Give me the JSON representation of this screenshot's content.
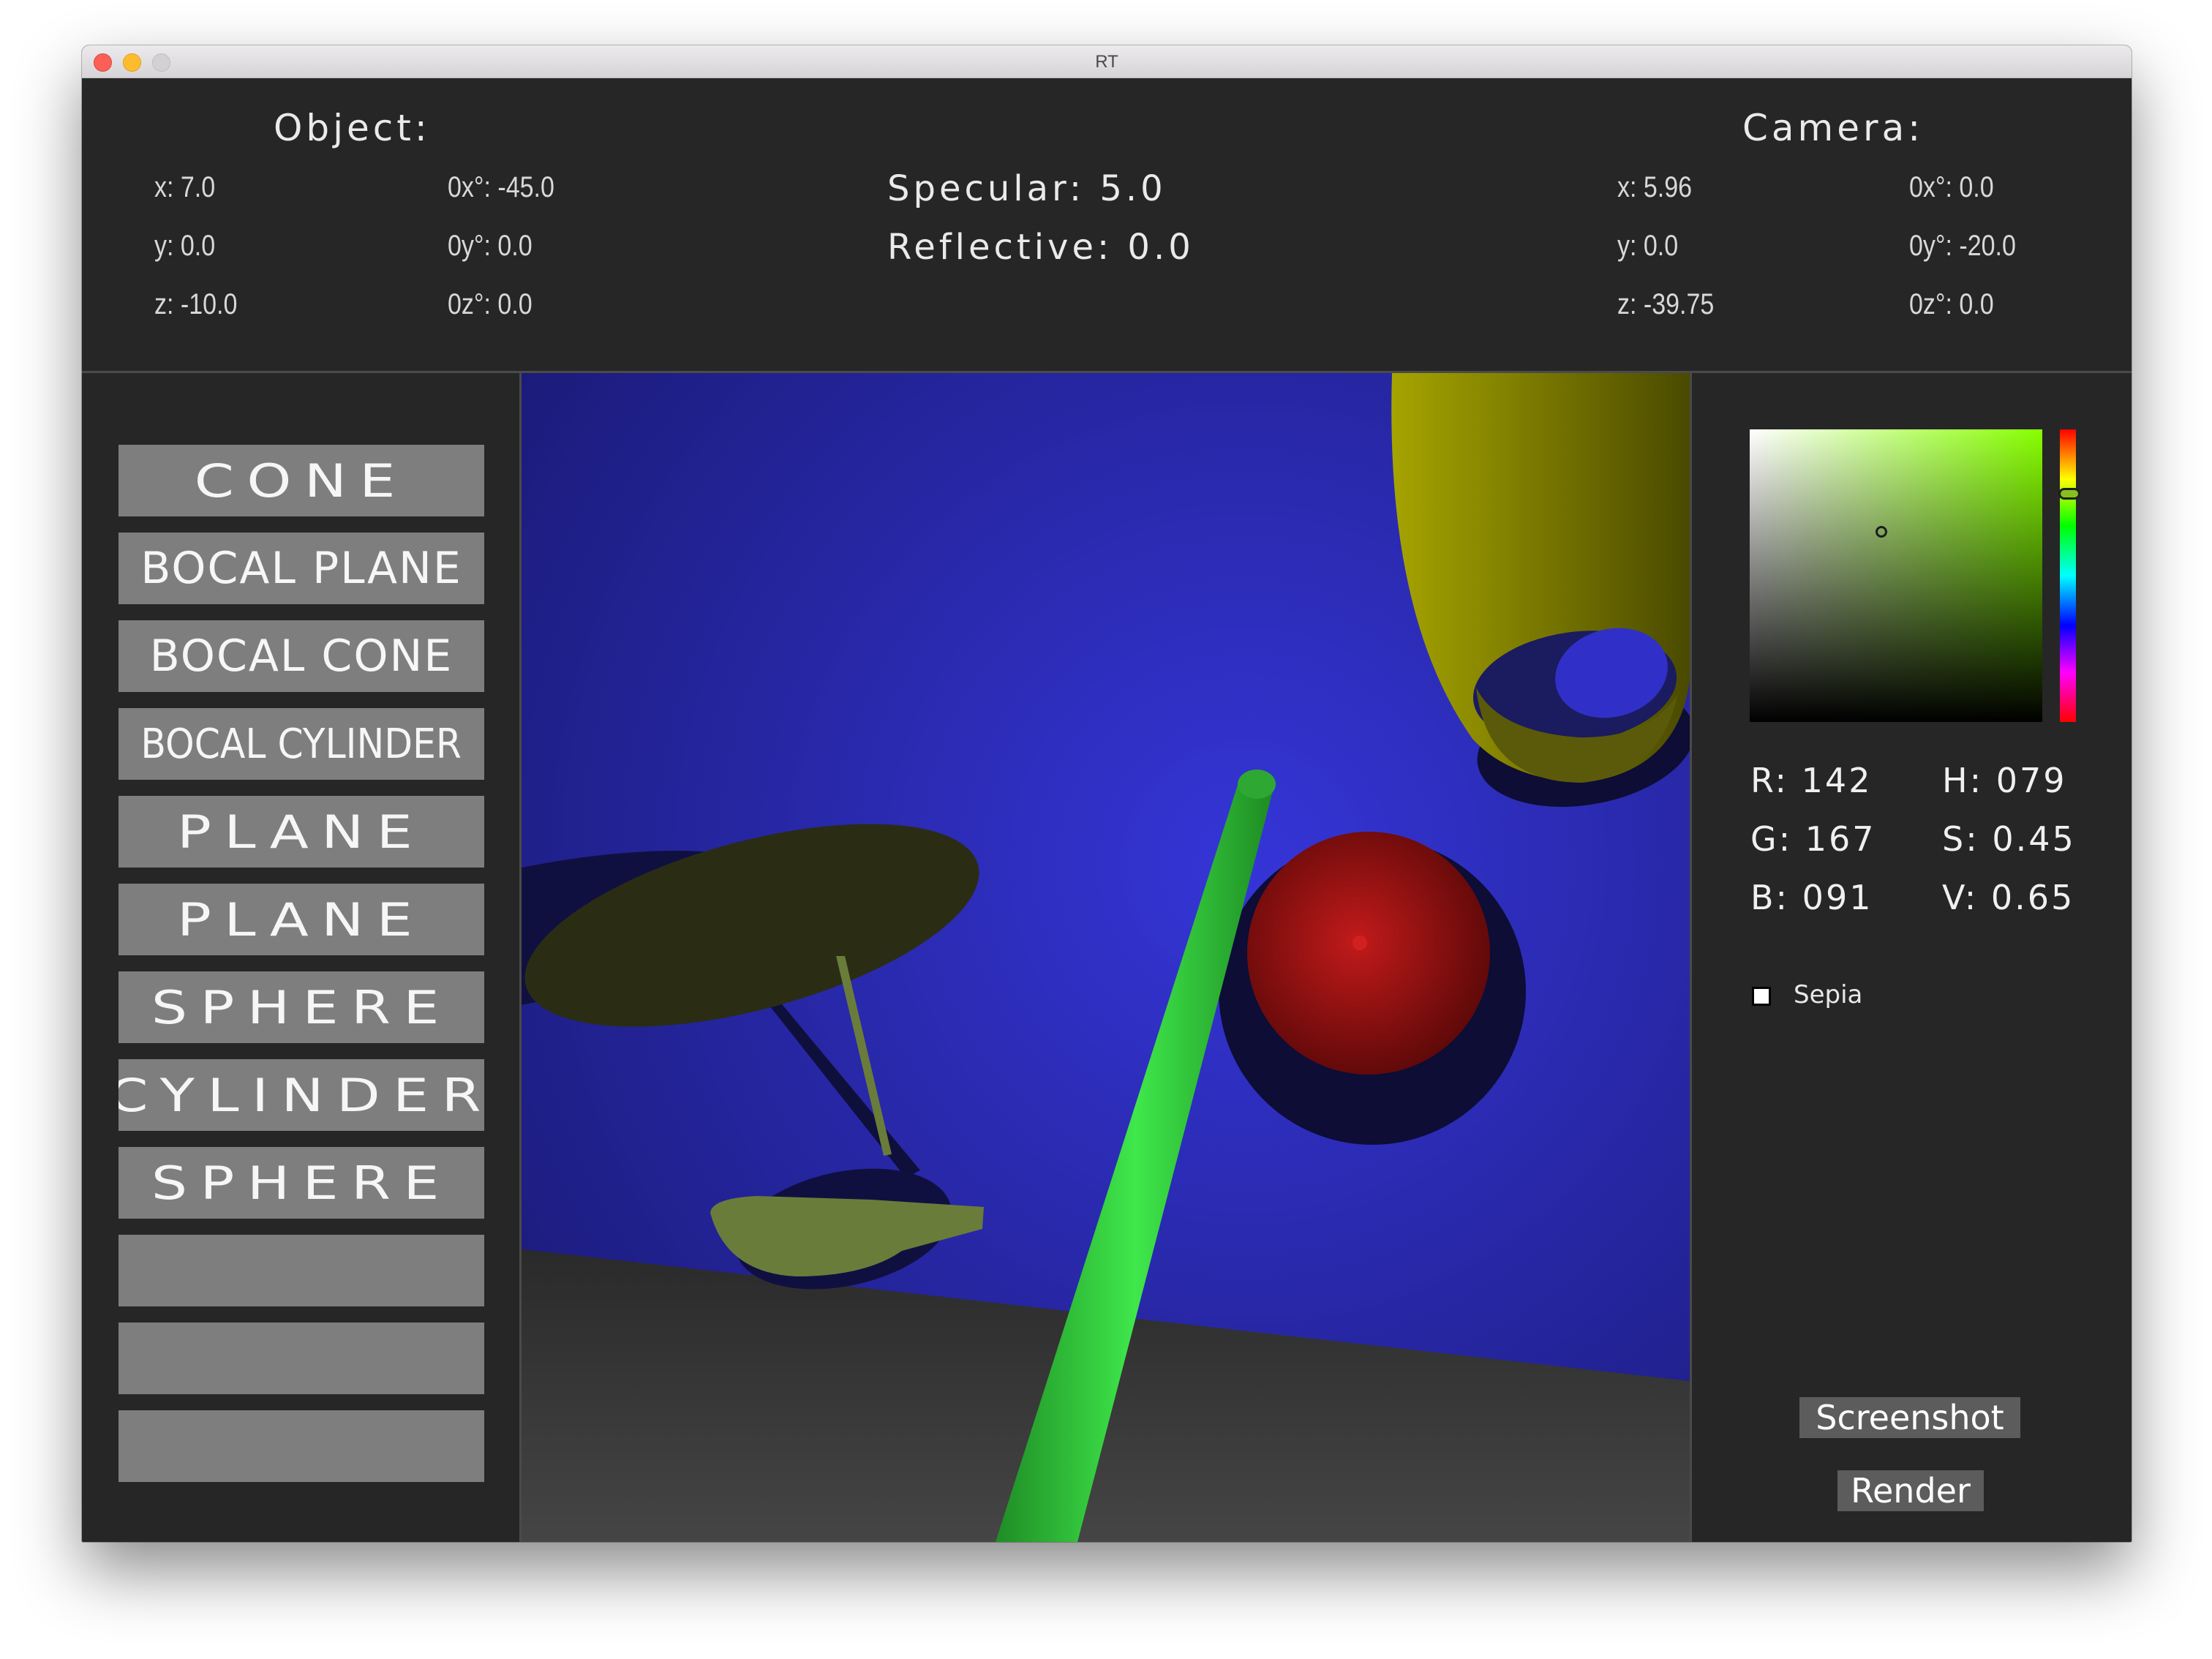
{
  "window": {
    "title": "RT"
  },
  "object": {
    "heading": "Object:",
    "x": "x: 7.0",
    "y": "y: 0.0",
    "z": "z: -10.0",
    "ox": "0x°: -45.0",
    "oy": "0y°: 0.0",
    "oz": "0z°: 0.0"
  },
  "material": {
    "specular": "Specular: 5.0",
    "reflective": "Reflective: 0.0"
  },
  "camera": {
    "heading": "Camera:",
    "x": "x: 5.96",
    "y": "y: 0.0",
    "z": "z: -39.75",
    "ox": "0x°: 0.0",
    "oy": "0y°: -20.0",
    "oz": "0z°: 0.0"
  },
  "object_list": [
    {
      "label": "CONE",
      "style": "wide"
    },
    {
      "label": "BOCAL PLANE",
      "style": "normal"
    },
    {
      "label": "BOCAL CONE",
      "style": "normal"
    },
    {
      "label": "BOCAL CYLINDER",
      "style": "narrow"
    },
    {
      "label": "PLANE",
      "style": "wide"
    },
    {
      "label": "PLANE",
      "style": "wide"
    },
    {
      "label": "SPHERE",
      "style": "wide"
    },
    {
      "label": "CYLINDER",
      "style": "wide"
    },
    {
      "label": "SPHERE",
      "style": "wide"
    },
    {
      "label": "",
      "style": "empty"
    },
    {
      "label": "",
      "style": "empty"
    },
    {
      "label": "",
      "style": "empty"
    }
  ],
  "color_picker": {
    "r": "R: 142",
    "g": "G: 167",
    "b": "B: 091",
    "h": "H: 079",
    "s": "S: 0.45",
    "v": "V: 0.65",
    "hue_deg": 79,
    "saturation": 0.45,
    "value": 0.65,
    "current_hex": "#8ea75b"
  },
  "sepia": {
    "label": "Sepia",
    "checked": false
  },
  "actions": {
    "screenshot": "Screenshot",
    "render": "Render"
  },
  "scene_colors": {
    "wall": "#2f2fc8",
    "floor": "#3a3a3a",
    "shadow": "#0f0f3c",
    "cone_yellow": "#a6a600",
    "dark_plane": "#2a2d14",
    "olive_disc": "#6a7c3a",
    "green_cylinder": "#2fcc3a",
    "red_sphere": "#a01010"
  }
}
